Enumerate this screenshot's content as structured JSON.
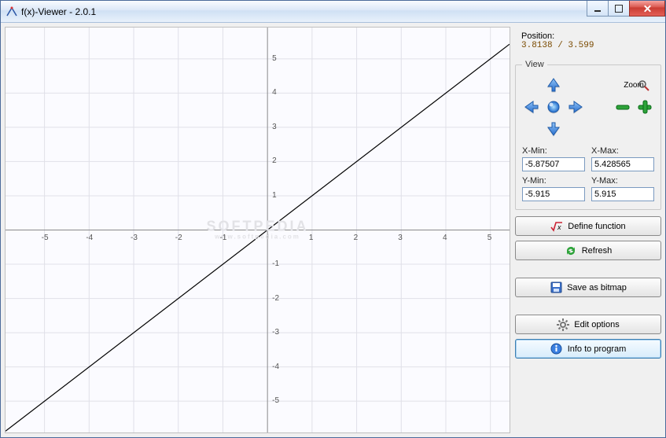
{
  "window": {
    "title": "f(x)-Viewer - 2.0.1"
  },
  "position": {
    "label": "Position:",
    "value": "3.8138 / 3.599"
  },
  "view_panel": {
    "legend": "View",
    "zoom_label": "Zoom",
    "ranges": {
      "xmin": {
        "label": "X-Min:",
        "value": "-5.87507"
      },
      "xmax": {
        "label": "X-Max:",
        "value": "5.428565"
      },
      "ymin": {
        "label": "Y-Min:",
        "value": "-5.915"
      },
      "ymax": {
        "label": "Y-Max:",
        "value": "5.915"
      }
    }
  },
  "buttons": {
    "define": "Define function",
    "refresh": "Refresh",
    "save": "Save as bitmap",
    "options": "Edit options",
    "info": "Info to program"
  },
  "watermark": {
    "main": "SOFTPEDIA",
    "sub": "www.softpedia.com"
  },
  "chart_data": {
    "type": "line",
    "title": "",
    "xlabel": "",
    "ylabel": "",
    "xlim": [
      -5.87507,
      5.428565
    ],
    "ylim": [
      -5.915,
      5.915
    ],
    "x_ticks": [
      -5,
      -4,
      -3,
      -2,
      -1,
      1,
      2,
      3,
      4,
      5
    ],
    "y_ticks": [
      -5,
      -4,
      -3,
      -2,
      -1,
      1,
      2,
      3,
      4,
      5
    ],
    "series": [
      {
        "name": "y = x",
        "x": [
          -5.87507,
          5.428565
        ],
        "y": [
          -5.87507,
          5.428565
        ]
      }
    ],
    "grid": true,
    "cursor_position": {
      "x": 3.8138,
      "y": 3.599
    }
  }
}
